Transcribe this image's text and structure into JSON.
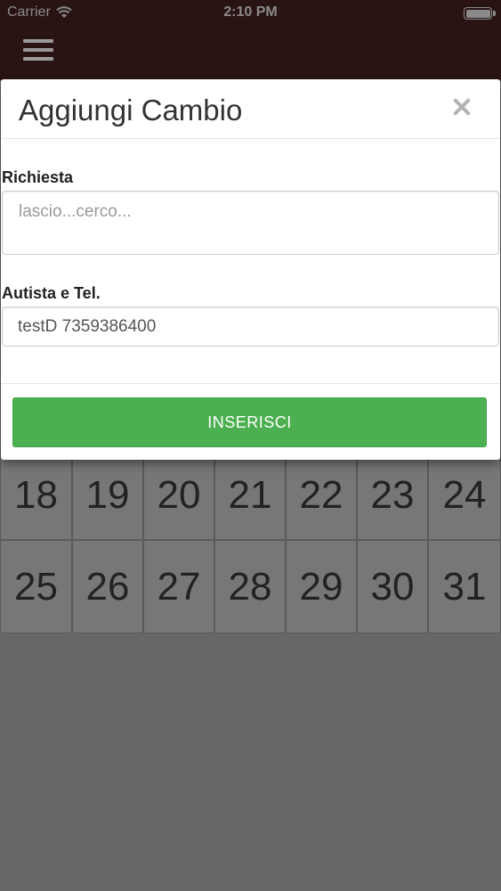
{
  "status_bar": {
    "carrier": "Carrier",
    "time": "2:10 PM"
  },
  "navbar": {
    "menu_icon": "hamburger-menu-icon",
    "background_color": "#2a1313"
  },
  "modal": {
    "title": "Aggiungi Cambio",
    "close_icon": "close-icon",
    "fields": {
      "richiesta": {
        "label": "Richiesta",
        "value": "",
        "placeholder": "lascio...cerco..."
      },
      "autista": {
        "label": "Autista e Tel.",
        "value": "testD 7359386400"
      }
    },
    "submit_label": "INSERISCI",
    "submit_color": "#4caf50"
  },
  "calendar": {
    "rows": [
      [
        "18",
        "19",
        "20",
        "21",
        "22",
        "23",
        "24"
      ],
      [
        "25",
        "26",
        "27",
        "28",
        "29",
        "30",
        "31"
      ]
    ]
  }
}
